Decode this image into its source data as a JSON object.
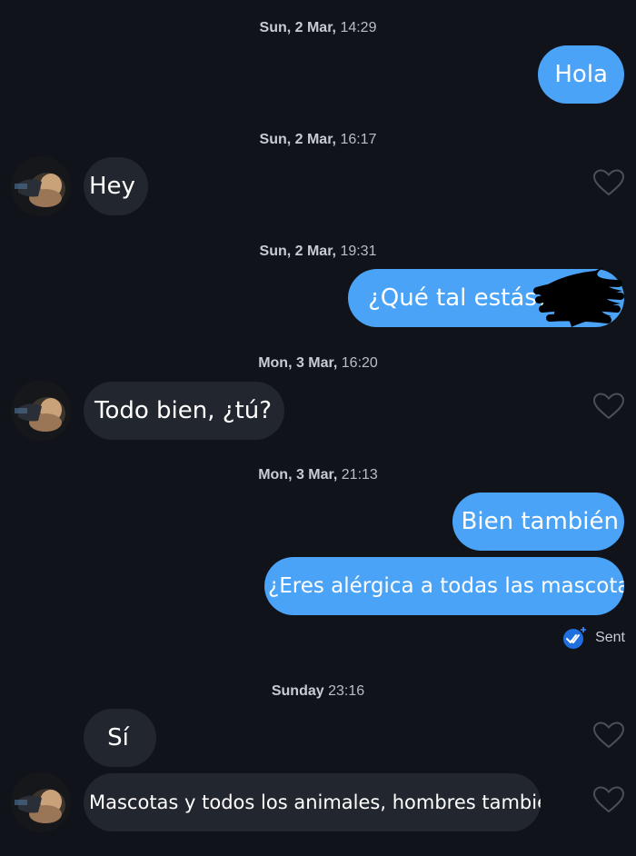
{
  "messages": [
    {
      "type": "timestamp",
      "day": "Sun, 2 Mar,",
      "time": "14:29"
    },
    {
      "type": "out",
      "text": "Hola"
    },
    {
      "type": "timestamp",
      "day": "Sun, 2 Mar,",
      "time": "16:17"
    },
    {
      "type": "in",
      "text": "Hey"
    },
    {
      "type": "timestamp",
      "day": "Sun, 2 Mar,",
      "time": "19:31"
    },
    {
      "type": "out",
      "text": "¿Qué tal estás?"
    },
    {
      "type": "timestamp",
      "day": "Mon, 3 Mar,",
      "time": "16:20"
    },
    {
      "type": "in",
      "text": "Todo bien, ¿tú?"
    },
    {
      "type": "timestamp",
      "day": "Mon, 3 Mar,",
      "time": "21:13"
    },
    {
      "type": "out",
      "text": "Bien también"
    },
    {
      "type": "out",
      "text": "¿Eres alérgica a todas las mascotas?"
    },
    {
      "type": "timestamp",
      "day": "Sunday",
      "time": "23:16"
    },
    {
      "type": "in",
      "text": "Sí"
    },
    {
      "type": "in",
      "text": "Mascotas y todos los animales, hombres también"
    }
  ],
  "status": {
    "label": "Sent",
    "icon": "double-check-icon"
  },
  "colors": {
    "background": "#10141a",
    "outgoing_bubble": "#4aa3f7",
    "incoming_bubble": "#22262e",
    "timestamp_text": "#b9bdc4",
    "sent_icon": "#1f6fe0"
  },
  "icons": {
    "like": "heart-outline-icon",
    "avatar": "contact-avatar",
    "redaction": "redaction-scribble"
  }
}
